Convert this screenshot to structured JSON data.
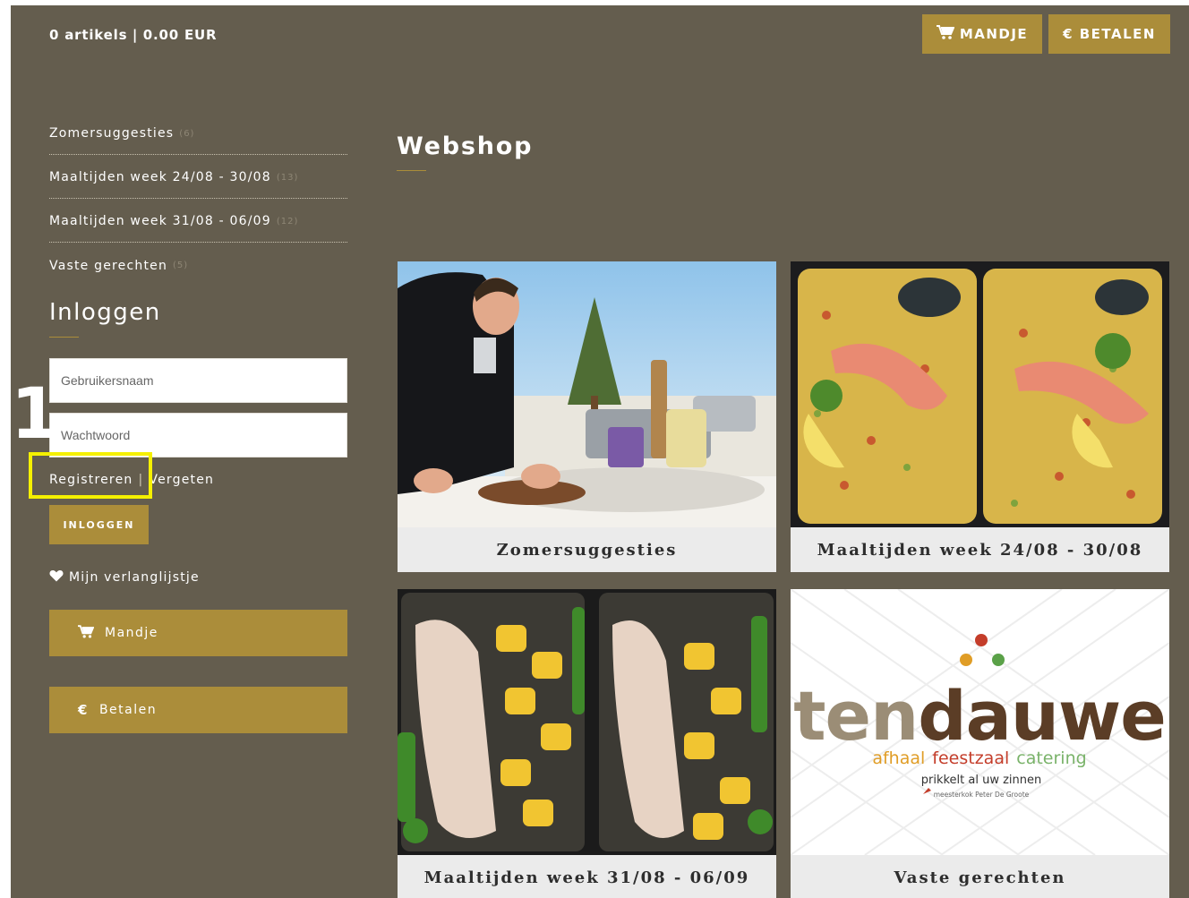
{
  "header": {
    "cart_summary": {
      "count": "0 artikels",
      "separator": "|",
      "total": "0.00 EUR"
    },
    "cart_button": "MANDJE",
    "pay_button": "€ BETALEN",
    "cart_icon": "cart-icon"
  },
  "sidebar": {
    "categories": [
      {
        "label": "Zomersuggesties",
        "count": "(6)"
      },
      {
        "label": "Maaltijden week 24/08 - 30/08",
        "count": "(13)"
      },
      {
        "label": "Maaltijden week 31/08 - 06/09",
        "count": "(12)"
      },
      {
        "label": "Vaste gerechten",
        "count": "(5)"
      }
    ],
    "login": {
      "title": "Inloggen",
      "username_placeholder": "Gebruikersnaam",
      "password_placeholder": "Wachtwoord",
      "register_link": "Registreren",
      "link_separator": "|",
      "forgot_link": "Vergeten",
      "submit": "INLOGGEN"
    },
    "annotation_marker": "1",
    "wishlist": {
      "label": "Mijn verlanglijstje",
      "icon": "heart-icon"
    },
    "cart_button": {
      "label": "Mandje",
      "icon": "cart-icon"
    },
    "pay_button": {
      "label": "Betalen",
      "icon": "euro-icon"
    }
  },
  "main": {
    "title": "Webshop",
    "tiles": [
      {
        "caption": "Zomersuggesties"
      },
      {
        "caption": "Maaltijden week 24/08 - 30/08"
      },
      {
        "caption": "Maaltijden week 31/08 - 06/09"
      },
      {
        "caption": "Vaste gerechten",
        "logo": {
          "name": "tendauwe",
          "tagline_words": [
            "afhaal",
            "feestzaal",
            "catering"
          ],
          "slogan": "prikkelt al uw zinnen",
          "chef": "meesterkok Peter De Groote"
        }
      }
    ]
  },
  "colors": {
    "background": "#645d4e",
    "accent": "#ab8d3a",
    "highlight": "#f5f000"
  }
}
